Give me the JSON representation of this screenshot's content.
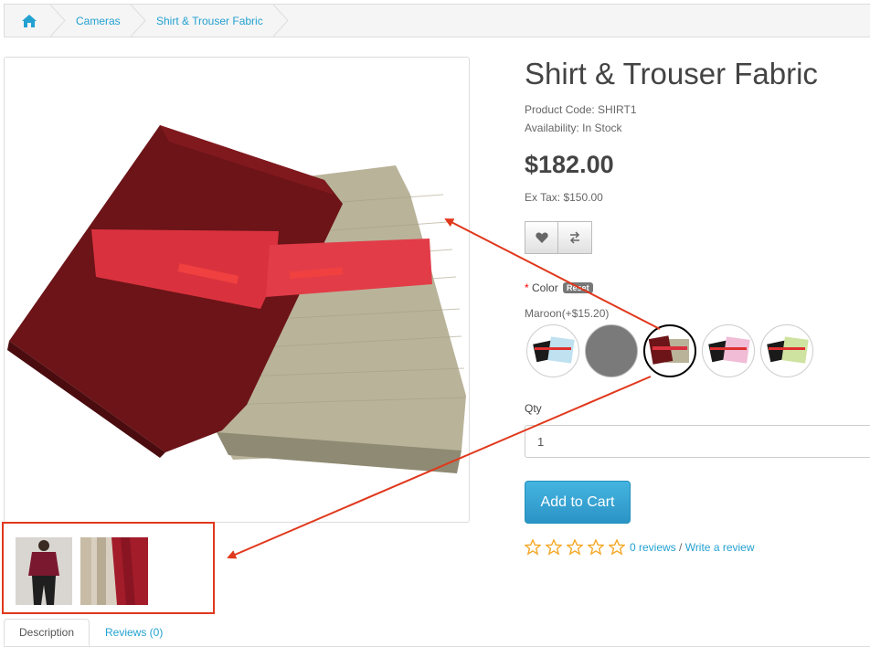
{
  "breadcrumb": {
    "home_icon": "home-icon",
    "items": [
      {
        "label": "Cameras"
      },
      {
        "label": "Shirt & Trouser Fabric"
      }
    ]
  },
  "product": {
    "title": "Shirt & Trouser Fabric",
    "code_line": "Product Code: SHIRT1",
    "availability_line": "Availability: In Stock",
    "price": "$182.00",
    "ex_tax": "Ex Tax: $150.00",
    "wishlist_icon": "heart-icon",
    "compare_icon": "exchange-icon"
  },
  "options": {
    "color_required": "*",
    "color_label": "Color",
    "reset_label": "Reset",
    "selected_value": "Maroon(+$15.20)",
    "swatches": [
      "black-lightblue",
      "grey",
      "maroon-beige",
      "black-pink",
      "black-lightgreen"
    ],
    "selected_index": 2
  },
  "qty": {
    "label": "Qty",
    "value": "1"
  },
  "cart": {
    "button_label": "Add to Cart"
  },
  "rating": {
    "stars_filled": 0,
    "stars_total": 5,
    "reviews_link": "0 reviews",
    "separator": " / ",
    "write_link": "Write a review"
  },
  "tabs": [
    {
      "label": "Description"
    },
    {
      "label": "Reviews (0)"
    }
  ],
  "colors": {
    "link": "#23a1d1",
    "annotation": "#e0381c",
    "cart_button": "#2b94c6"
  }
}
